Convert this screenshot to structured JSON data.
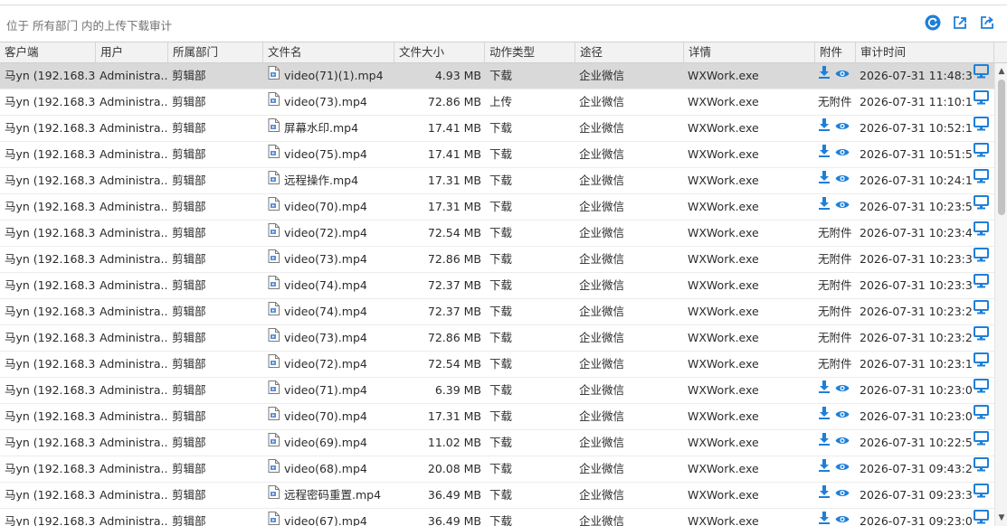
{
  "breadcrumb": "位于 所有部门 内的上传下载审计",
  "toolbar": {
    "refresh_icon": "refresh-icon",
    "export_icon": "export-icon",
    "share_icon": "share-icon",
    "accent_color": "#1e7fd8"
  },
  "columns": [
    "客户端",
    "用户",
    "所属部门",
    "文件名",
    "文件大小",
    "动作类型",
    "途径",
    "详情",
    "附件",
    "审计时间"
  ],
  "no_attachment_label": "无附件",
  "rows": [
    {
      "client": "马yn (192.168.3...",
      "user": "Administra...",
      "dept": "剪辑部",
      "file": "video(71)(1).mp4",
      "size": "4.93 MB",
      "action": "下载",
      "channel": "企业微信",
      "detail": "WXWork.exe",
      "attachment": true,
      "time": "2026-07-31 11:48:32",
      "selected": true
    },
    {
      "client": "马yn (192.168.3...",
      "user": "Administra...",
      "dept": "剪辑部",
      "file": "video(73).mp4",
      "size": "72.86 MB",
      "action": "上传",
      "channel": "企业微信",
      "detail": "WXWork.exe",
      "attachment": false,
      "time": "2026-07-31 11:10:10"
    },
    {
      "client": "马yn (192.168.3...",
      "user": "Administra...",
      "dept": "剪辑部",
      "file": "屏幕水印.mp4",
      "size": "17.41 MB",
      "action": "下载",
      "channel": "企业微信",
      "detail": "WXWork.exe",
      "attachment": true,
      "time": "2026-07-31 10:52:10"
    },
    {
      "client": "马yn (192.168.3...",
      "user": "Administra...",
      "dept": "剪辑部",
      "file": "video(75).mp4",
      "size": "17.41 MB",
      "action": "下载",
      "channel": "企业微信",
      "detail": "WXWork.exe",
      "attachment": true,
      "time": "2026-07-31 10:51:50"
    },
    {
      "client": "马yn (192.168.3...",
      "user": "Administra...",
      "dept": "剪辑部",
      "file": "远程操作.mp4",
      "size": "17.31 MB",
      "action": "下载",
      "channel": "企业微信",
      "detail": "WXWork.exe",
      "attachment": true,
      "time": "2026-07-31 10:24:18"
    },
    {
      "client": "马yn (192.168.3...",
      "user": "Administra...",
      "dept": "剪辑部",
      "file": "video(70).mp4",
      "size": "17.31 MB",
      "action": "下载",
      "channel": "企业微信",
      "detail": "WXWork.exe",
      "attachment": true,
      "time": "2026-07-31 10:23:58"
    },
    {
      "client": "马yn (192.168.3...",
      "user": "Administra...",
      "dept": "剪辑部",
      "file": "video(72).mp4",
      "size": "72.54 MB",
      "action": "下载",
      "channel": "企业微信",
      "detail": "WXWork.exe",
      "attachment": false,
      "time": "2026-07-31 10:23:48"
    },
    {
      "client": "马yn (192.168.3...",
      "user": "Administra...",
      "dept": "剪辑部",
      "file": "video(73).mp4",
      "size": "72.86 MB",
      "action": "下载",
      "channel": "企业微信",
      "detail": "WXWork.exe",
      "attachment": false,
      "time": "2026-07-31 10:23:38"
    },
    {
      "client": "马yn (192.168.3...",
      "user": "Administra...",
      "dept": "剪辑部",
      "file": "video(74).mp4",
      "size": "72.37 MB",
      "action": "下载",
      "channel": "企业微信",
      "detail": "WXWork.exe",
      "attachment": false,
      "time": "2026-07-31 10:23:38"
    },
    {
      "client": "马yn (192.168.3...",
      "user": "Administra...",
      "dept": "剪辑部",
      "file": "video(74).mp4",
      "size": "72.37 MB",
      "action": "下载",
      "channel": "企业微信",
      "detail": "WXWork.exe",
      "attachment": false,
      "time": "2026-07-31 10:23:28"
    },
    {
      "client": "马yn (192.168.3...",
      "user": "Administra...",
      "dept": "剪辑部",
      "file": "video(73).mp4",
      "size": "72.86 MB",
      "action": "下载",
      "channel": "企业微信",
      "detail": "WXWork.exe",
      "attachment": false,
      "time": "2026-07-31 10:23:28"
    },
    {
      "client": "马yn (192.168.3...",
      "user": "Administra...",
      "dept": "剪辑部",
      "file": "video(72).mp4",
      "size": "72.54 MB",
      "action": "下载",
      "channel": "企业微信",
      "detail": "WXWork.exe",
      "attachment": false,
      "time": "2026-07-31 10:23:18"
    },
    {
      "client": "马yn (192.168.3...",
      "user": "Administra...",
      "dept": "剪辑部",
      "file": "video(71).mp4",
      "size": "6.39 MB",
      "action": "下载",
      "channel": "企业微信",
      "detail": "WXWork.exe",
      "attachment": true,
      "time": "2026-07-31 10:23:08"
    },
    {
      "client": "马yn (192.168.3...",
      "user": "Administra...",
      "dept": "剪辑部",
      "file": "video(70).mp4",
      "size": "17.31 MB",
      "action": "下载",
      "channel": "企业微信",
      "detail": "WXWork.exe",
      "attachment": true,
      "time": "2026-07-31 10:23:08"
    },
    {
      "client": "马yn (192.168.3...",
      "user": "Administra...",
      "dept": "剪辑部",
      "file": "video(69).mp4",
      "size": "11.02 MB",
      "action": "下载",
      "channel": "企业微信",
      "detail": "WXWork.exe",
      "attachment": true,
      "time": "2026-07-31 10:22:58"
    },
    {
      "client": "马yn (192.168.3...",
      "user": "Administra...",
      "dept": "剪辑部",
      "file": "video(68).mp4",
      "size": "20.08 MB",
      "action": "下载",
      "channel": "企业微信",
      "detail": "WXWork.exe",
      "attachment": true,
      "time": "2026-07-31 09:43:26"
    },
    {
      "client": "马yn (192.168.3...",
      "user": "Administra...",
      "dept": "剪辑部",
      "file": "远程密码重置.mp4",
      "size": "36.49 MB",
      "action": "下载",
      "channel": "企业微信",
      "detail": "WXWork.exe",
      "attachment": true,
      "time": "2026-07-31 09:23:35"
    },
    {
      "client": "马yn (192.168.3...",
      "user": "Administra...",
      "dept": "剪辑部",
      "file": "video(67).mp4",
      "size": "36.49 MB",
      "action": "下载",
      "channel": "企业微信",
      "detail": "WXWork.exe",
      "attachment": true,
      "time": "2026-07-31 09:23:05"
    }
  ]
}
